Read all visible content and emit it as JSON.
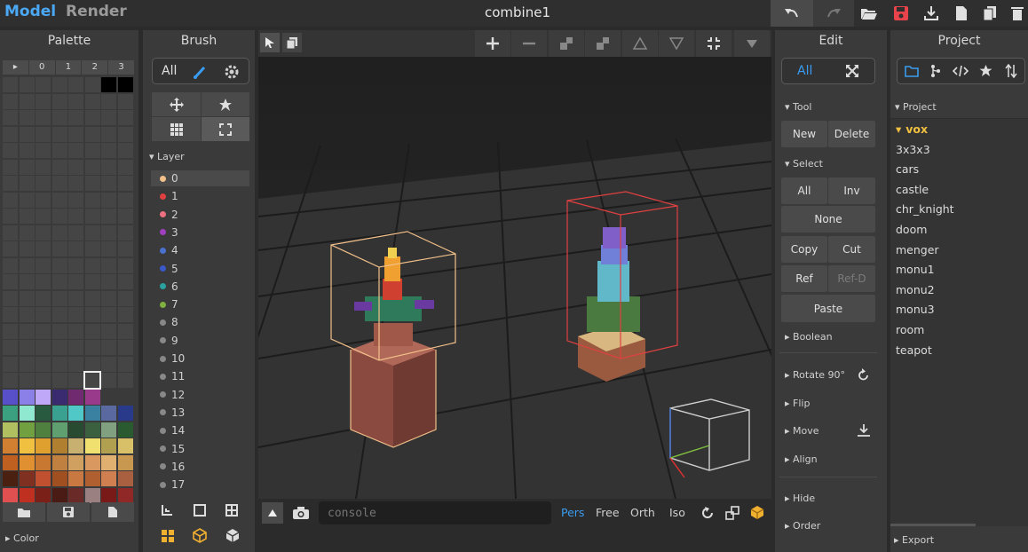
{
  "menu": {
    "model": "Model",
    "render": "Render"
  },
  "title": "combine1",
  "palette": {
    "title": "Palette",
    "tabs": [
      "▸",
      "0",
      "1",
      "2",
      "3"
    ],
    "color_label": "▸ Color"
  },
  "brush": {
    "title": "Brush",
    "all": "All",
    "layer_label": "Layer",
    "layers": [
      {
        "label": "0",
        "color": "#f2c08a"
      },
      {
        "label": "1",
        "color": "#e04040"
      },
      {
        "label": "2",
        "color": "#ee7080"
      },
      {
        "label": "3",
        "color": "#a040c0"
      },
      {
        "label": "4",
        "color": "#4a70d0"
      },
      {
        "label": "5",
        "color": "#3a58c8"
      },
      {
        "label": "6",
        "color": "#2aa0a0"
      },
      {
        "label": "7",
        "color": "#80b040"
      },
      {
        "label": "8",
        "color": "#888888"
      },
      {
        "label": "9",
        "color": "#888888"
      },
      {
        "label": "10",
        "color": "#888888"
      },
      {
        "label": "11",
        "color": "#888888"
      },
      {
        "label": "12",
        "color": "#888888"
      },
      {
        "label": "13",
        "color": "#888888"
      },
      {
        "label": "14",
        "color": "#888888"
      },
      {
        "label": "15",
        "color": "#888888"
      },
      {
        "label": "16",
        "color": "#888888"
      },
      {
        "label": "17",
        "color": "#888888"
      }
    ]
  },
  "viewport": {
    "console_placeholder": "console",
    "views": [
      "Pers",
      "Free",
      "Orth",
      "Iso"
    ]
  },
  "edit": {
    "title": "Edit",
    "all": "All",
    "tool": "Tool",
    "new": "New",
    "delete": "Delete",
    "select": "Select",
    "sel_all": "All",
    "inv": "Inv",
    "none": "None",
    "copy": "Copy",
    "cut": "Cut",
    "ref": "Ref",
    "refd": "Ref-D",
    "paste": "Paste",
    "boolean": "Boolean",
    "rotate": "Rotate 90°",
    "flip": "Flip",
    "move": "Move",
    "align": "Align",
    "hide": "Hide",
    "order": "Order"
  },
  "project": {
    "title": "Project",
    "tree_label": "Project",
    "items": [
      "vox",
      "3x3x3",
      "cars",
      "castle",
      "chr_knight",
      "doom",
      "menger",
      "monu1",
      "monu2",
      "monu3",
      "room",
      "teapot"
    ],
    "export": "Export"
  },
  "colors": {
    "accent": "#3a9cf0",
    "save": "#e8434b",
    "folder_yellow": "#f0c040"
  }
}
